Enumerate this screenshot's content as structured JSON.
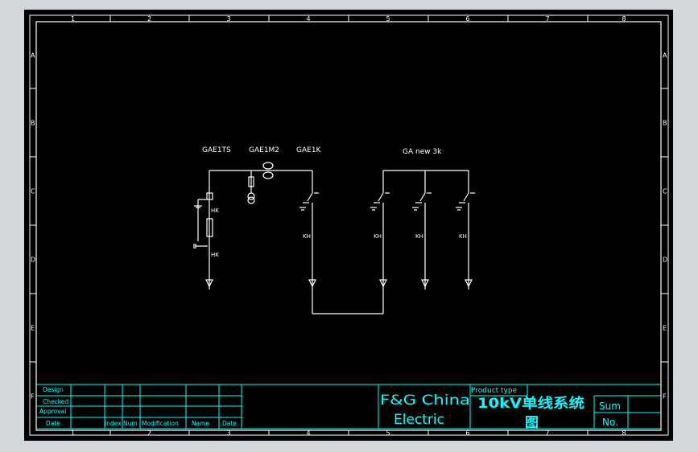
{
  "colors": {
    "background": "#000000",
    "frame": "#ffffff",
    "zone_text": "#ffffff",
    "title_block": "#00ffff",
    "title_text": "#00ffff",
    "chinese_title": "#00ffff",
    "diagram_lines": "#ffffff"
  },
  "zones": {
    "columns": [
      "1",
      "2",
      "3",
      "4",
      "5",
      "6",
      "7",
      "8"
    ],
    "rows": [
      "A",
      "B",
      "C",
      "D",
      "E",
      "F"
    ]
  },
  "diagram": {
    "labels": {
      "panel1": "GAE1TS",
      "panel2": "GAE1M2",
      "panel3": "GAE1K",
      "group": "GA new 3k"
    }
  },
  "title_block": {
    "design": "Design",
    "checked": "Checked",
    "approval": "Approval",
    "date": "Date",
    "index": "Index",
    "num": "Num",
    "modification": "Modification",
    "name": "Name",
    "date2": "Date",
    "company_line1": "F&G China",
    "company_line2": "Electric",
    "product_type_label": "Product type",
    "product_type_value": "10kV单线系统",
    "product_type_value2": "图",
    "sum": "Sum",
    "no": "No."
  }
}
